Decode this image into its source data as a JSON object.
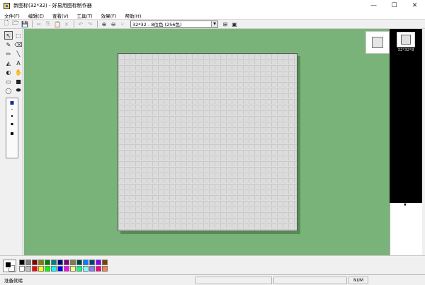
{
  "window": {
    "title": "新图标(32*32) - 好易用图标制作器",
    "minimize_label": "—",
    "maximize_label": "☐",
    "close_label": "✕"
  },
  "menu": [
    "文件(F)",
    "编辑(E)",
    "查看(V)",
    "工具(T)",
    "效果(F)",
    "帮助(H)"
  ],
  "toolbar": {
    "format_value": "32*32 - 8位色 (256色)",
    "buttons": [
      {
        "name": "new-icon",
        "glyph": "🗋",
        "disabled": false
      },
      {
        "name": "open-icon",
        "glyph": "🗁",
        "disabled": false
      },
      {
        "name": "save-icon",
        "glyph": "💾",
        "disabled": false
      },
      {
        "name": "cut-icon",
        "glyph": "✂",
        "disabled": true
      },
      {
        "name": "copy-icon",
        "glyph": "⎘",
        "disabled": true
      },
      {
        "name": "paste-icon",
        "glyph": "📋",
        "disabled": true
      },
      {
        "name": "delete-icon",
        "glyph": "✕",
        "disabled": true
      },
      {
        "name": "undo-icon",
        "glyph": "↶",
        "disabled": true
      },
      {
        "name": "redo-icon",
        "glyph": "↷",
        "disabled": true
      },
      {
        "name": "zoom-in-icon",
        "glyph": "⊕",
        "disabled": false
      },
      {
        "name": "zoom-out-icon",
        "glyph": "⊖",
        "disabled": false
      },
      {
        "name": "zoom-fit-icon",
        "glyph": "⌕",
        "disabled": true
      }
    ],
    "after_select": [
      {
        "name": "add-format-icon",
        "glyph": "⊞"
      },
      {
        "name": "image-format-icon",
        "glyph": "▣"
      }
    ]
  },
  "tools": [
    {
      "name": "select-arrow-icon",
      "glyph": "↖",
      "active": true
    },
    {
      "name": "rect-select-icon",
      "glyph": "⬚",
      "active": false
    },
    {
      "name": "picker-icon",
      "glyph": "✎",
      "active": false
    },
    {
      "name": "eraser-icon",
      "glyph": "⌫",
      "active": false
    },
    {
      "name": "pencil-icon",
      "glyph": "✏",
      "active": false
    },
    {
      "name": "line-icon",
      "glyph": "╲",
      "active": false
    },
    {
      "name": "fill-icon",
      "glyph": "◭",
      "active": false
    },
    {
      "name": "text-icon",
      "glyph": "A",
      "active": false
    },
    {
      "name": "color-replace-icon",
      "glyph": "◐",
      "active": false
    },
    {
      "name": "hand-icon",
      "glyph": "✋",
      "active": false
    },
    {
      "name": "rectangle-icon",
      "glyph": "▭",
      "active": false
    },
    {
      "name": "filled-rectangle-icon",
      "glyph": "■",
      "active": false
    },
    {
      "name": "ellipse-icon",
      "glyph": "◯",
      "active": false
    },
    {
      "name": "filled-ellipse-icon",
      "glyph": "⬬",
      "active": false
    }
  ],
  "brush_sizes": [
    "1",
    "2",
    "3",
    "4",
    "5"
  ],
  "preview": {
    "size_label": "32*32*8"
  },
  "palette": {
    "colors": [
      "#000000",
      "#808080",
      "#800000",
      "#808000",
      "#008000",
      "#008080",
      "#000080",
      "#800080",
      "#808040",
      "#004040",
      "#0080ff",
      "#004080",
      "#8000ff",
      "#804000",
      "#ffffff",
      "#c0c0c0",
      "#ff0000",
      "#ffff00",
      "#00ff00",
      "#00ffff",
      "#0000ff",
      "#ff00ff",
      "#ffff80",
      "#00ff80",
      "#80ffff",
      "#8080ff",
      "#ff0080",
      "#ff8040"
    ]
  },
  "status": {
    "text": "准备就绪",
    "num": "NUM"
  }
}
